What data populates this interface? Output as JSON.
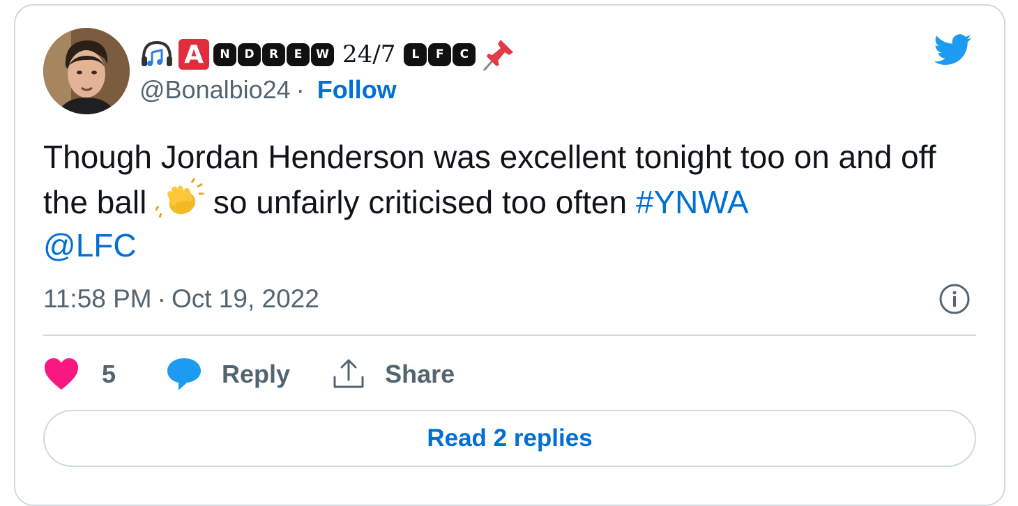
{
  "author": {
    "display_name_letter_a": "A",
    "display_name_blocks": [
      "N",
      "D",
      "R",
      "E",
      "W"
    ],
    "display_name_plain": "24/7",
    "display_name_blocks_2": [
      "L",
      "F",
      "C"
    ],
    "handle": "@Bonalbio24",
    "separator": "·",
    "follow_label": "Follow"
  },
  "tweet": {
    "text_part1": "Though Jordan Henderson was excellent tonight too on and off the ball ",
    "text_part2": " so unfairly criticised too often ",
    "hashtag": "#YNWA",
    "mention": "@LFC"
  },
  "meta": {
    "time": "11:58 PM",
    "separator": "·",
    "date": "Oct 19, 2022"
  },
  "actions": {
    "like_count": "5",
    "reply_label": "Reply",
    "share_label": "Share"
  },
  "read_replies_label": "Read 2 replies",
  "colors": {
    "link": "#006fd6",
    "heart": "#f91880",
    "bubble": "#1d9bf0",
    "twitter_blue": "#1d9bf0",
    "name_red_badge": "#e02d3c"
  }
}
